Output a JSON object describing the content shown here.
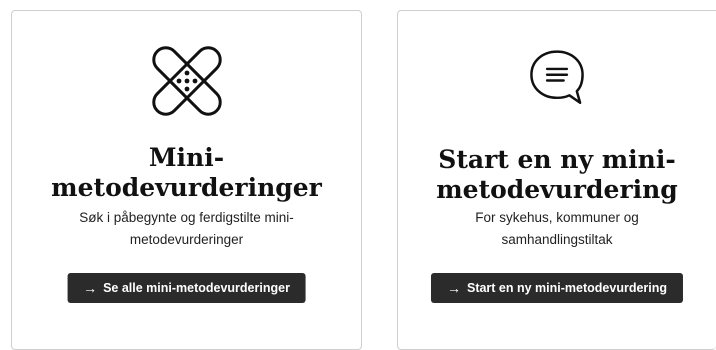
{
  "cards": [
    {
      "icon": "bandage-icon",
      "title": "Mini-\nmetodevurderinger",
      "description": "Søk i påbegynte og ferdigstilte mini-metodevurderinger",
      "button_label": "Se alle mini-metodevurderinger"
    },
    {
      "icon": "speech-bubble-icon",
      "title": "Start en ny mini-\nmetodevurdering",
      "description": "For sykehus, kommuner og samhandlingstiltak",
      "button_label": "Start en ny mini-metodevurdering"
    }
  ],
  "button_arrow": "→",
  "colors": {
    "button_bg": "#2b2b2b",
    "border": "#cfcfcf",
    "text": "#111111"
  }
}
